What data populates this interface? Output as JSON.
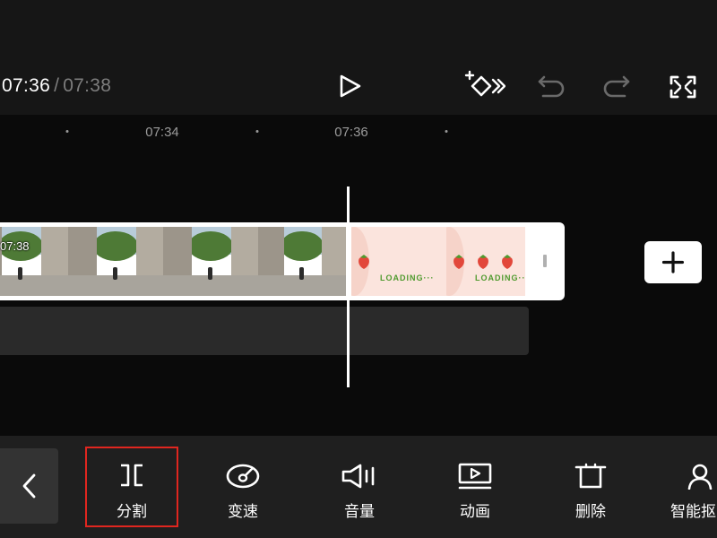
{
  "header": {
    "current_time": "07:36",
    "separator": "/",
    "total_time": "07:38",
    "icons": {
      "play": "play-icon",
      "keyframe": "add-keyframe-icon",
      "undo": "undo-icon",
      "redo": "redo-icon",
      "fullscreen": "fullscreen-icon"
    }
  },
  "timeline": {
    "ruler_labels": [
      "07:34",
      "07:36"
    ],
    "clip_start_time": "07:38",
    "loading_texts": [
      "LOADING···",
      "LOADING···"
    ],
    "add_clip_icon": "plus-icon"
  },
  "toolbar": {
    "back_icon": "chevron-left-icon",
    "tools": [
      {
        "label": "分割",
        "icon": "split-icon",
        "selected": true
      },
      {
        "label": "变速",
        "icon": "speed-icon",
        "selected": false
      },
      {
        "label": "音量",
        "icon": "volume-icon",
        "selected": false
      },
      {
        "label": "动画",
        "icon": "animation-icon",
        "selected": false
      },
      {
        "label": "删除",
        "icon": "delete-icon",
        "selected": false
      },
      {
        "label": "智能抠",
        "icon": "smart-cutout-icon",
        "selected": false
      }
    ]
  },
  "colors": {
    "background": "#161616",
    "timeline_background": "#0a0a0a",
    "toolbar_background": "#1f1f1f",
    "selection_outline": "#e0261f",
    "muted_text": "#7d7d7d"
  }
}
